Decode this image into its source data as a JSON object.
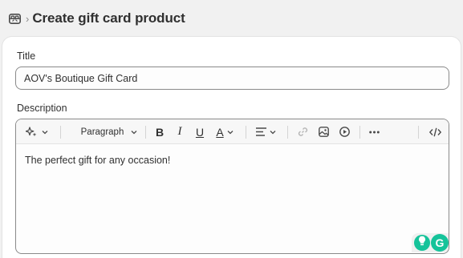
{
  "header": {
    "breadcrumb_icon": "gift-card-icon",
    "separator_icon": "chevron-right-icon",
    "title": "Create gift card product"
  },
  "form": {
    "title_label": "Title",
    "title_value": "AOV's Boutique Gift Card",
    "description_label": "Description",
    "toolbar": {
      "ai_icon": "sparkle-icon",
      "paragraph_label": "Paragraph",
      "bold": "B",
      "italic": "I",
      "underline": "U",
      "text_color": "A",
      "align_icon": "align-left-icon",
      "link_icon": "link-icon",
      "image_icon": "image-icon",
      "video_icon": "play-circle-icon",
      "more_icon": "more-horizontal-icon",
      "code_icon": "code-icon"
    },
    "description_value": "The perfect gift for any occasion!"
  },
  "grammarly": {
    "bulb_icon": "lightbulb-icon",
    "letter": "G",
    "accent": "#15c39a"
  }
}
